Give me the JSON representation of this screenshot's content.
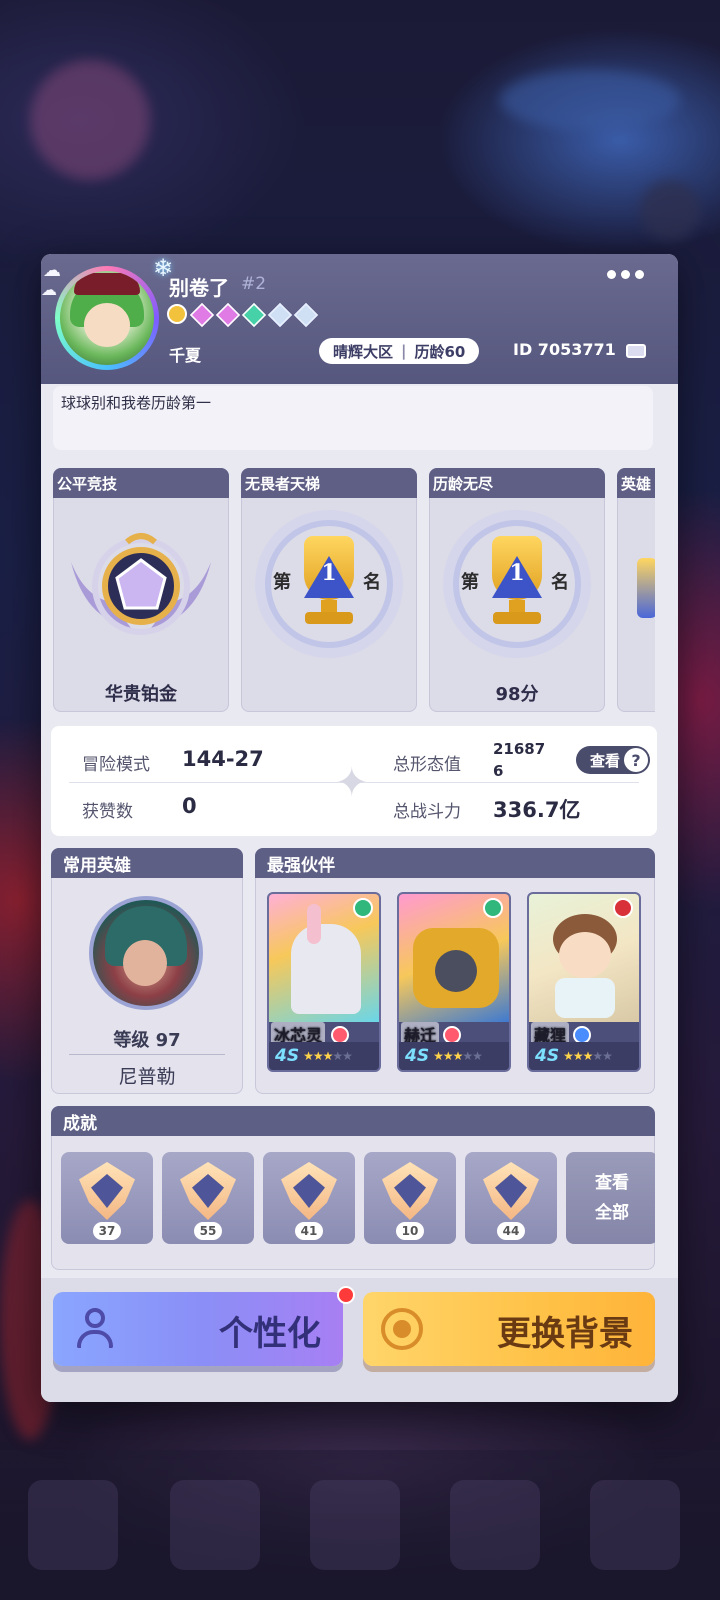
{
  "profile": {
    "nickname": "别卷了",
    "rank_tag": "#2",
    "player_name": "千夏",
    "server": "晴辉大区",
    "separator": "|",
    "age": "历龄60",
    "uid": "ID 7053771",
    "bio": "球球别和我卷历龄第一",
    "gems": [
      "gold",
      "pink",
      "pink",
      "teal",
      "clear",
      "clear"
    ]
  },
  "ranks": [
    {
      "title": "公平竞技",
      "value": "华贵铂金",
      "emblem": "platinum-emblem-icon"
    },
    {
      "title": "无畏者天梯",
      "value": "",
      "emblem": "first-place-trophy-icon",
      "rank_no": "1",
      "prefix": "第",
      "suffix": "名"
    },
    {
      "title": "历龄无尽",
      "value": "98分",
      "emblem": "first-place-trophy-icon",
      "rank_no": "1",
      "prefix": "第",
      "suffix": "名"
    },
    {
      "title": "英雄",
      "value": ""
    }
  ],
  "stats": {
    "adventure_label": "冒险模式",
    "adventure_value": "144-27",
    "form_label": "总形态值",
    "form_value_line1": "21687",
    "form_value_line2": "6",
    "likes_label": "获赞数",
    "likes_value": "0",
    "power_label": "总战斗力",
    "power_value": "336.7亿",
    "view_button": "查看",
    "help": "?"
  },
  "common_hero": {
    "title": "常用英雄",
    "level": "等级 97",
    "name": "尼普勒"
  },
  "partners": {
    "title": "最强伙伴",
    "items": [
      {
        "name": "冰芯灵",
        "grade": "4S",
        "stars_on": "★★★",
        "stars_off": "★★",
        "badge_color": "#2fb77c",
        "heart_color": "#ff5a6e"
      },
      {
        "name": "赫迁",
        "grade": "4S",
        "stars_on": "★★★",
        "stars_off": "★★",
        "badge_color": "#2fb77c",
        "heart_color": "#ff5a6e"
      },
      {
        "name": "藏狸",
        "grade": "4S",
        "stars_on": "★★★",
        "stars_off": "★★",
        "badge_color": "#d8313a",
        "heart_color": "#4a8dff"
      }
    ]
  },
  "achievements": {
    "title": "成就",
    "counts": [
      "37",
      "55",
      "41",
      "10",
      "44"
    ],
    "view_all_line1": "查看",
    "view_all_line2": "全部"
  },
  "buttons": {
    "personalize": "个性化",
    "change_background": "更换背景"
  },
  "colors": {
    "panel_header": "#56577e",
    "accent_blue": "#8a8ff7",
    "accent_gold": "#ffc248"
  }
}
